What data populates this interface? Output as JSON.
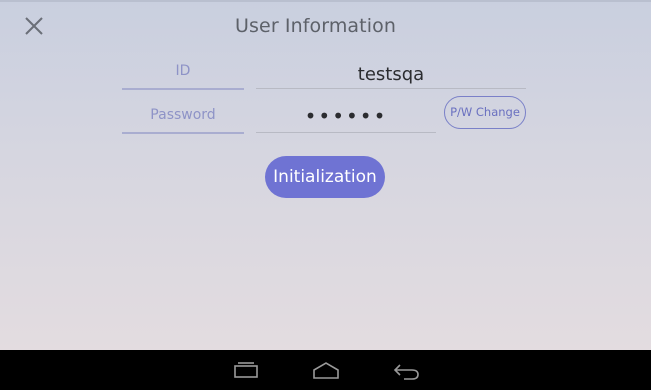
{
  "header": {
    "title": "User Information",
    "close_icon": "close-icon"
  },
  "form": {
    "id_label": "ID",
    "id_value": "testsqa",
    "password_label": "Password",
    "password_value": "••••••",
    "pw_change_label": "P/W Change",
    "init_label": "Initialization"
  },
  "navbar": {
    "recent_icon": "recent-apps-icon",
    "home_icon": "home-icon",
    "back_icon": "back-icon"
  },
  "colors": {
    "accent": "#6f73d3",
    "label": "#8e93c7"
  }
}
